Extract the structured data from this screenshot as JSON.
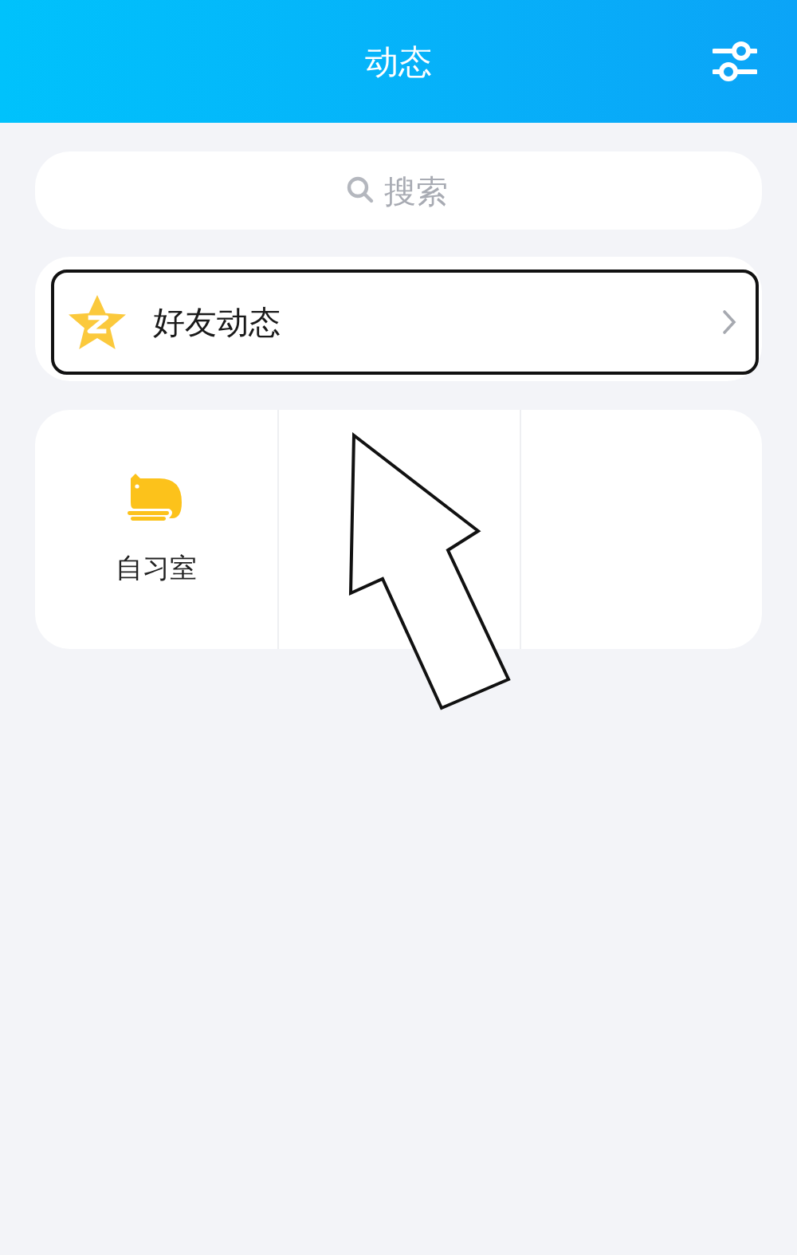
{
  "header": {
    "title": "动态"
  },
  "search": {
    "placeholder": "搜索"
  },
  "feed_items": [
    {
      "label": "好友动态",
      "highlighted": true
    }
  ],
  "apps": [
    {
      "label": "自习室"
    }
  ],
  "annotations": [
    {
      "kind": "arrow"
    }
  ]
}
